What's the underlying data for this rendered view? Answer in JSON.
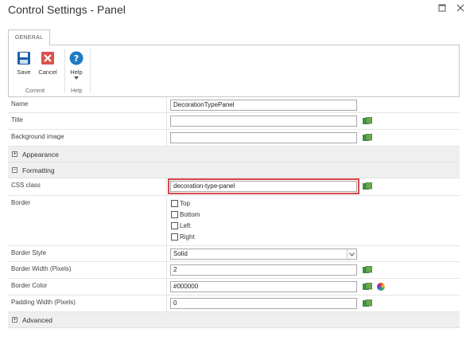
{
  "window": {
    "title": "Control Settings - Panel",
    "maximize_icon": "maximize-icon",
    "close_icon": "close-icon"
  },
  "ribbon": {
    "tab_label": "GENERAL",
    "buttons": [
      {
        "label": "Save",
        "icon": "save-icon",
        "color": "#1f5fa8"
      },
      {
        "label": "Cancel",
        "icon": "cancel-icon",
        "color": "#d9534f"
      },
      {
        "label": "Help",
        "icon": "help-icon",
        "color": "#1f7bc4"
      }
    ],
    "groups": [
      "Commit",
      "Help"
    ]
  },
  "fields": {
    "name": {
      "label": "Name",
      "value": "DecorationTypePanel"
    },
    "title": {
      "label": "Title",
      "value": ""
    },
    "background_image": {
      "label": "Background image",
      "value": ""
    },
    "css_class": {
      "label": "CSS class",
      "value": "decoration-type-panel"
    },
    "border": {
      "label": "Border",
      "options": [
        "Top",
        "Bottom",
        "Left",
        "Right"
      ],
      "checked": [
        false,
        false,
        false,
        false
      ]
    },
    "border_style": {
      "label": "Border Style",
      "value": "Solid"
    },
    "border_width": {
      "label": "Border Width (Pixels)",
      "value": "2"
    },
    "border_color": {
      "label": "Border Color",
      "value": "#000000"
    },
    "padding_width": {
      "label": "Padding Width (Pixels)",
      "value": "0"
    }
  },
  "sections": {
    "appearance": {
      "label": "Appearance",
      "toggle": "+"
    },
    "formatting": {
      "label": "Formatting",
      "toggle": "−"
    },
    "advanced": {
      "label": "Advanced",
      "toggle": "+"
    }
  },
  "colors": {
    "highlight": "#d9474b",
    "section_bg": "#efefef"
  }
}
